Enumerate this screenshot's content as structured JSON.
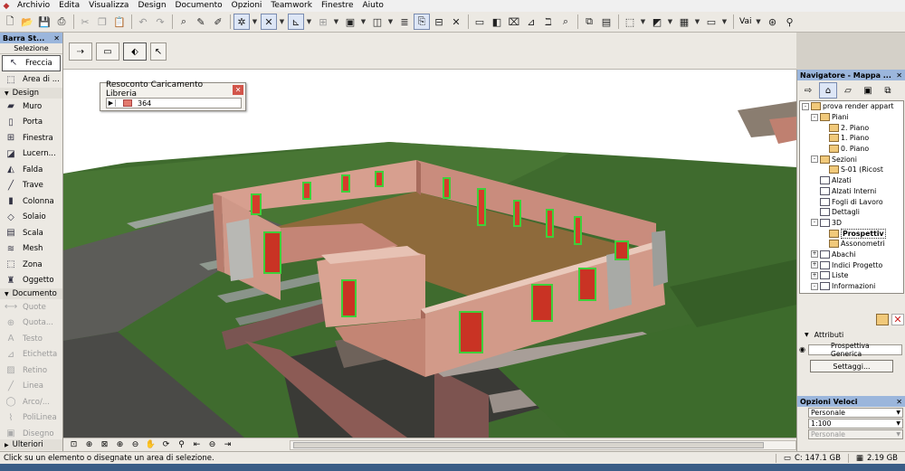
{
  "menu": [
    "Archivio",
    "Edita",
    "Visualizza",
    "Design",
    "Documento",
    "Opzioni",
    "Teamwork",
    "Finestre",
    "Aiuto"
  ],
  "toolbar": {
    "vai_label": "Vai"
  },
  "toolbox": {
    "title": "Barra St...",
    "subtitle": "Selezione",
    "selection_items": [
      {
        "label": "Freccia",
        "icon": "arrow-icon"
      },
      {
        "label": "Area di ...",
        "icon": "marquee-icon"
      }
    ],
    "design_label": "Design",
    "design_items": [
      {
        "label": "Muro"
      },
      {
        "label": "Porta"
      },
      {
        "label": "Finestra"
      },
      {
        "label": "Lucern..."
      },
      {
        "label": "Falda"
      },
      {
        "label": "Trave"
      },
      {
        "label": "Colonna"
      },
      {
        "label": "Solaio"
      },
      {
        "label": "Scala"
      },
      {
        "label": "Mesh"
      },
      {
        "label": "Zona"
      },
      {
        "label": "Oggetto"
      }
    ],
    "documento_label": "Documento",
    "doc_items": [
      {
        "label": "Quote"
      },
      {
        "label": "Quota..."
      },
      {
        "label": "Testo"
      },
      {
        "label": "Etichetta"
      },
      {
        "label": "Retino"
      },
      {
        "label": "Linea"
      },
      {
        "label": "Arco/..."
      },
      {
        "label": "PoliLinea"
      },
      {
        "label": "Disegno"
      }
    ],
    "ulteriori_label": "Ulteriori"
  },
  "library_dialog": {
    "title": "Resoconto Caricamento Libreria",
    "count": "364"
  },
  "navigator": {
    "title": "Navigatore - Mappa ...",
    "tree": [
      {
        "label": "prova render appart",
        "level": 0,
        "toggle": "-"
      },
      {
        "label": "Piani",
        "level": 1,
        "toggle": "-"
      },
      {
        "label": "2. Piano",
        "level": 2,
        "toggle": ""
      },
      {
        "label": "1. Piano",
        "level": 2,
        "toggle": ""
      },
      {
        "label": "0. Piano",
        "level": 2,
        "toggle": ""
      },
      {
        "label": "Sezioni",
        "level": 1,
        "toggle": "-"
      },
      {
        "label": "S-01 (Ricost",
        "level": 2,
        "toggle": ""
      },
      {
        "label": "Alzati",
        "level": 1,
        "toggle": ""
      },
      {
        "label": "Alzati Interni",
        "level": 1,
        "toggle": ""
      },
      {
        "label": "Fogli di Lavoro",
        "level": 1,
        "toggle": ""
      },
      {
        "label": "Dettagli",
        "level": 1,
        "toggle": ""
      },
      {
        "label": "3D",
        "level": 1,
        "toggle": "-"
      },
      {
        "label": "Prospettiv",
        "level": 2,
        "toggle": "",
        "selected": true
      },
      {
        "label": "Assonometri",
        "level": 2,
        "toggle": ""
      },
      {
        "label": "Abachi",
        "level": 1,
        "toggle": "+"
      },
      {
        "label": "Indici Progetto",
        "level": 1,
        "toggle": "+"
      },
      {
        "label": "Liste",
        "level": 1,
        "toggle": "+"
      },
      {
        "label": "Informazioni",
        "level": 1,
        "toggle": "-"
      }
    ],
    "attributes_label": "Attributi",
    "attribute_value": "Prospettiva Generica",
    "settings_button": "Settaggi..."
  },
  "quick_options": {
    "title": "Opzioni Veloci",
    "rows": [
      {
        "value": "Personale",
        "enabled": true
      },
      {
        "value": "1:100",
        "enabled": true
      },
      {
        "value": "Personale",
        "enabled": false
      }
    ]
  },
  "status": {
    "text": "Click su un elemento o disegnate un area di selezione.",
    "disk_c": "C: 147.1 GB",
    "ram": "2.19 GB"
  }
}
